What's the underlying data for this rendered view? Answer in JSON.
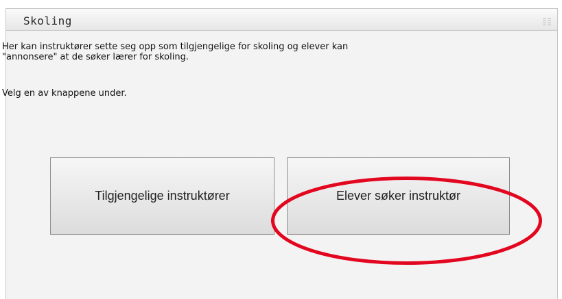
{
  "panel": {
    "title": "Skoling"
  },
  "content": {
    "intro_text": "Her kan instruktører sette seg opp som tilgjengelige for skoling og elever kan\n\"annonsere\" at de søker lærer for skoling.",
    "instruction_text": "Velg en av knappene under."
  },
  "buttons": {
    "available_instructors": "Tilgjengelige instruktører",
    "students_seeking_instructor": "Elever søker instruktør"
  },
  "icons": {
    "header_grip": "grip-icon"
  },
  "colors": {
    "highlight": "#e3061f"
  }
}
